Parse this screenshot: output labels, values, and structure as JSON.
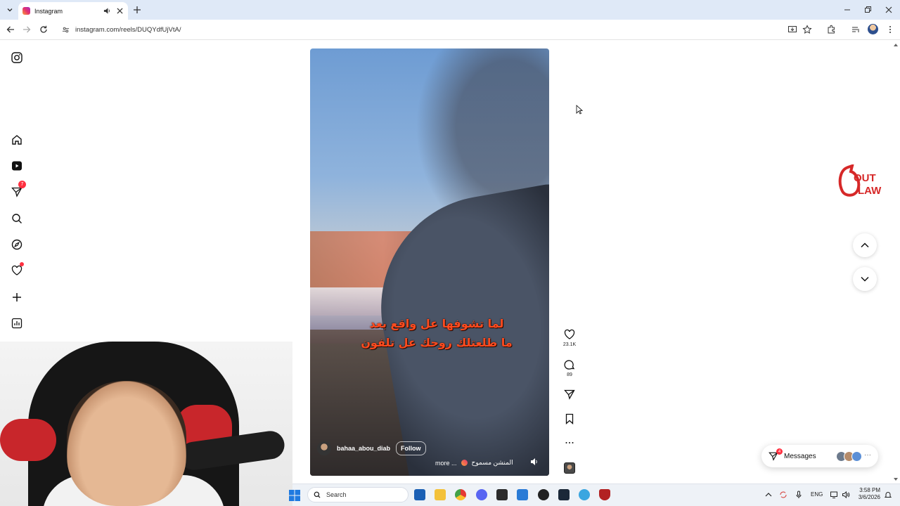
{
  "browser": {
    "tab_title": "Instagram",
    "url": "instagram.com/reels/DUQYdfUjVtA/"
  },
  "sidebar": {
    "notifications_badge": "7"
  },
  "reel": {
    "caption_line1": "لما تشوفها عل واقع بعد",
    "caption_line2": "ما طلعتلك روحك عل تلفون",
    "username": "bahaa_abou_diab",
    "follow_label": "Follow",
    "audio_text": "المنشن مسموح",
    "more_label": "more ...",
    "likes": "23.1K",
    "comments": "89"
  },
  "overlay_logo": {
    "text_line1": "OUT",
    "text_line2": "LAW",
    "color": "#d62828"
  },
  "messages": {
    "label": "Messages",
    "badge": "4"
  },
  "taskbar": {
    "search_placeholder": "Search",
    "language": "ENG",
    "time": "3:58 PM",
    "date": "3/6/2026"
  },
  "colors": {
    "tabbar": "#dfe9f7",
    "badge": "#ff3040",
    "caption": "#ff4b1f"
  }
}
